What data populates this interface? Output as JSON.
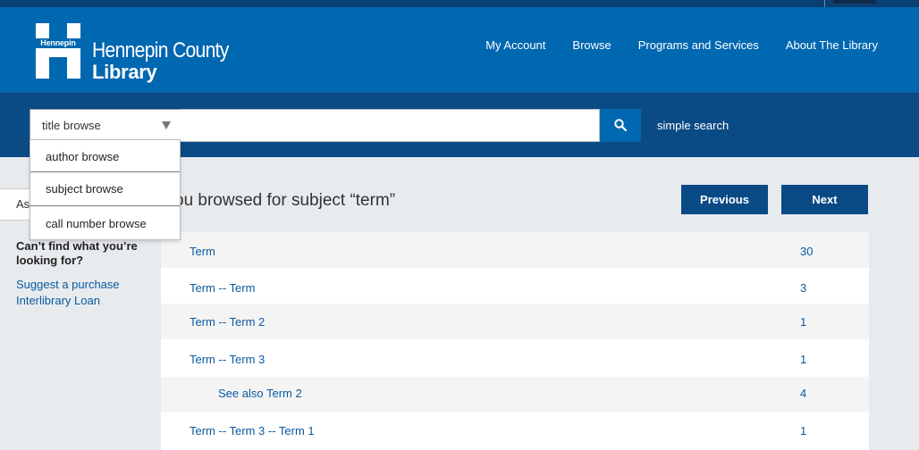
{
  "header": {
    "logo_word": "Hennepin",
    "brand_line1": "Hennepin County",
    "brand_line2": "Library",
    "nav": [
      "My Account",
      "Browse",
      "Programs and Services",
      "About The Library"
    ]
  },
  "search": {
    "selected": "title browse",
    "query": "",
    "options": [
      "author browse",
      "subject browse",
      "call number browse"
    ],
    "simple_link": "simple search",
    "search_icon": "magnifier-icon"
  },
  "sidebar": {
    "tab_label": "As",
    "cant_find": "Can’t find what you’re looking for?",
    "links": [
      "Suggest a purchase",
      "Interlibrary Loan"
    ]
  },
  "main": {
    "heading": "ou browsed for subject “term”",
    "previous": "Previous",
    "next": "Next",
    "rows": [
      {
        "label": "Term",
        "count": "30",
        "indent": false
      },
      {
        "label": "Term -- Term",
        "count": "3",
        "indent": false
      },
      {
        "label": "Term -- Term 2",
        "count": "1",
        "indent": false
      },
      {
        "label": "Term -- Term 3",
        "count": "1",
        "indent": false
      },
      {
        "label": "See also Term 2",
        "count": "4",
        "indent": true
      },
      {
        "label": "Term -- Term 3 -- Term 1",
        "count": "1",
        "indent": false
      }
    ]
  },
  "colors": {
    "header_blue": "#0067b1",
    "band_navy": "#0a4a85",
    "link_blue": "#0a5aa0"
  }
}
